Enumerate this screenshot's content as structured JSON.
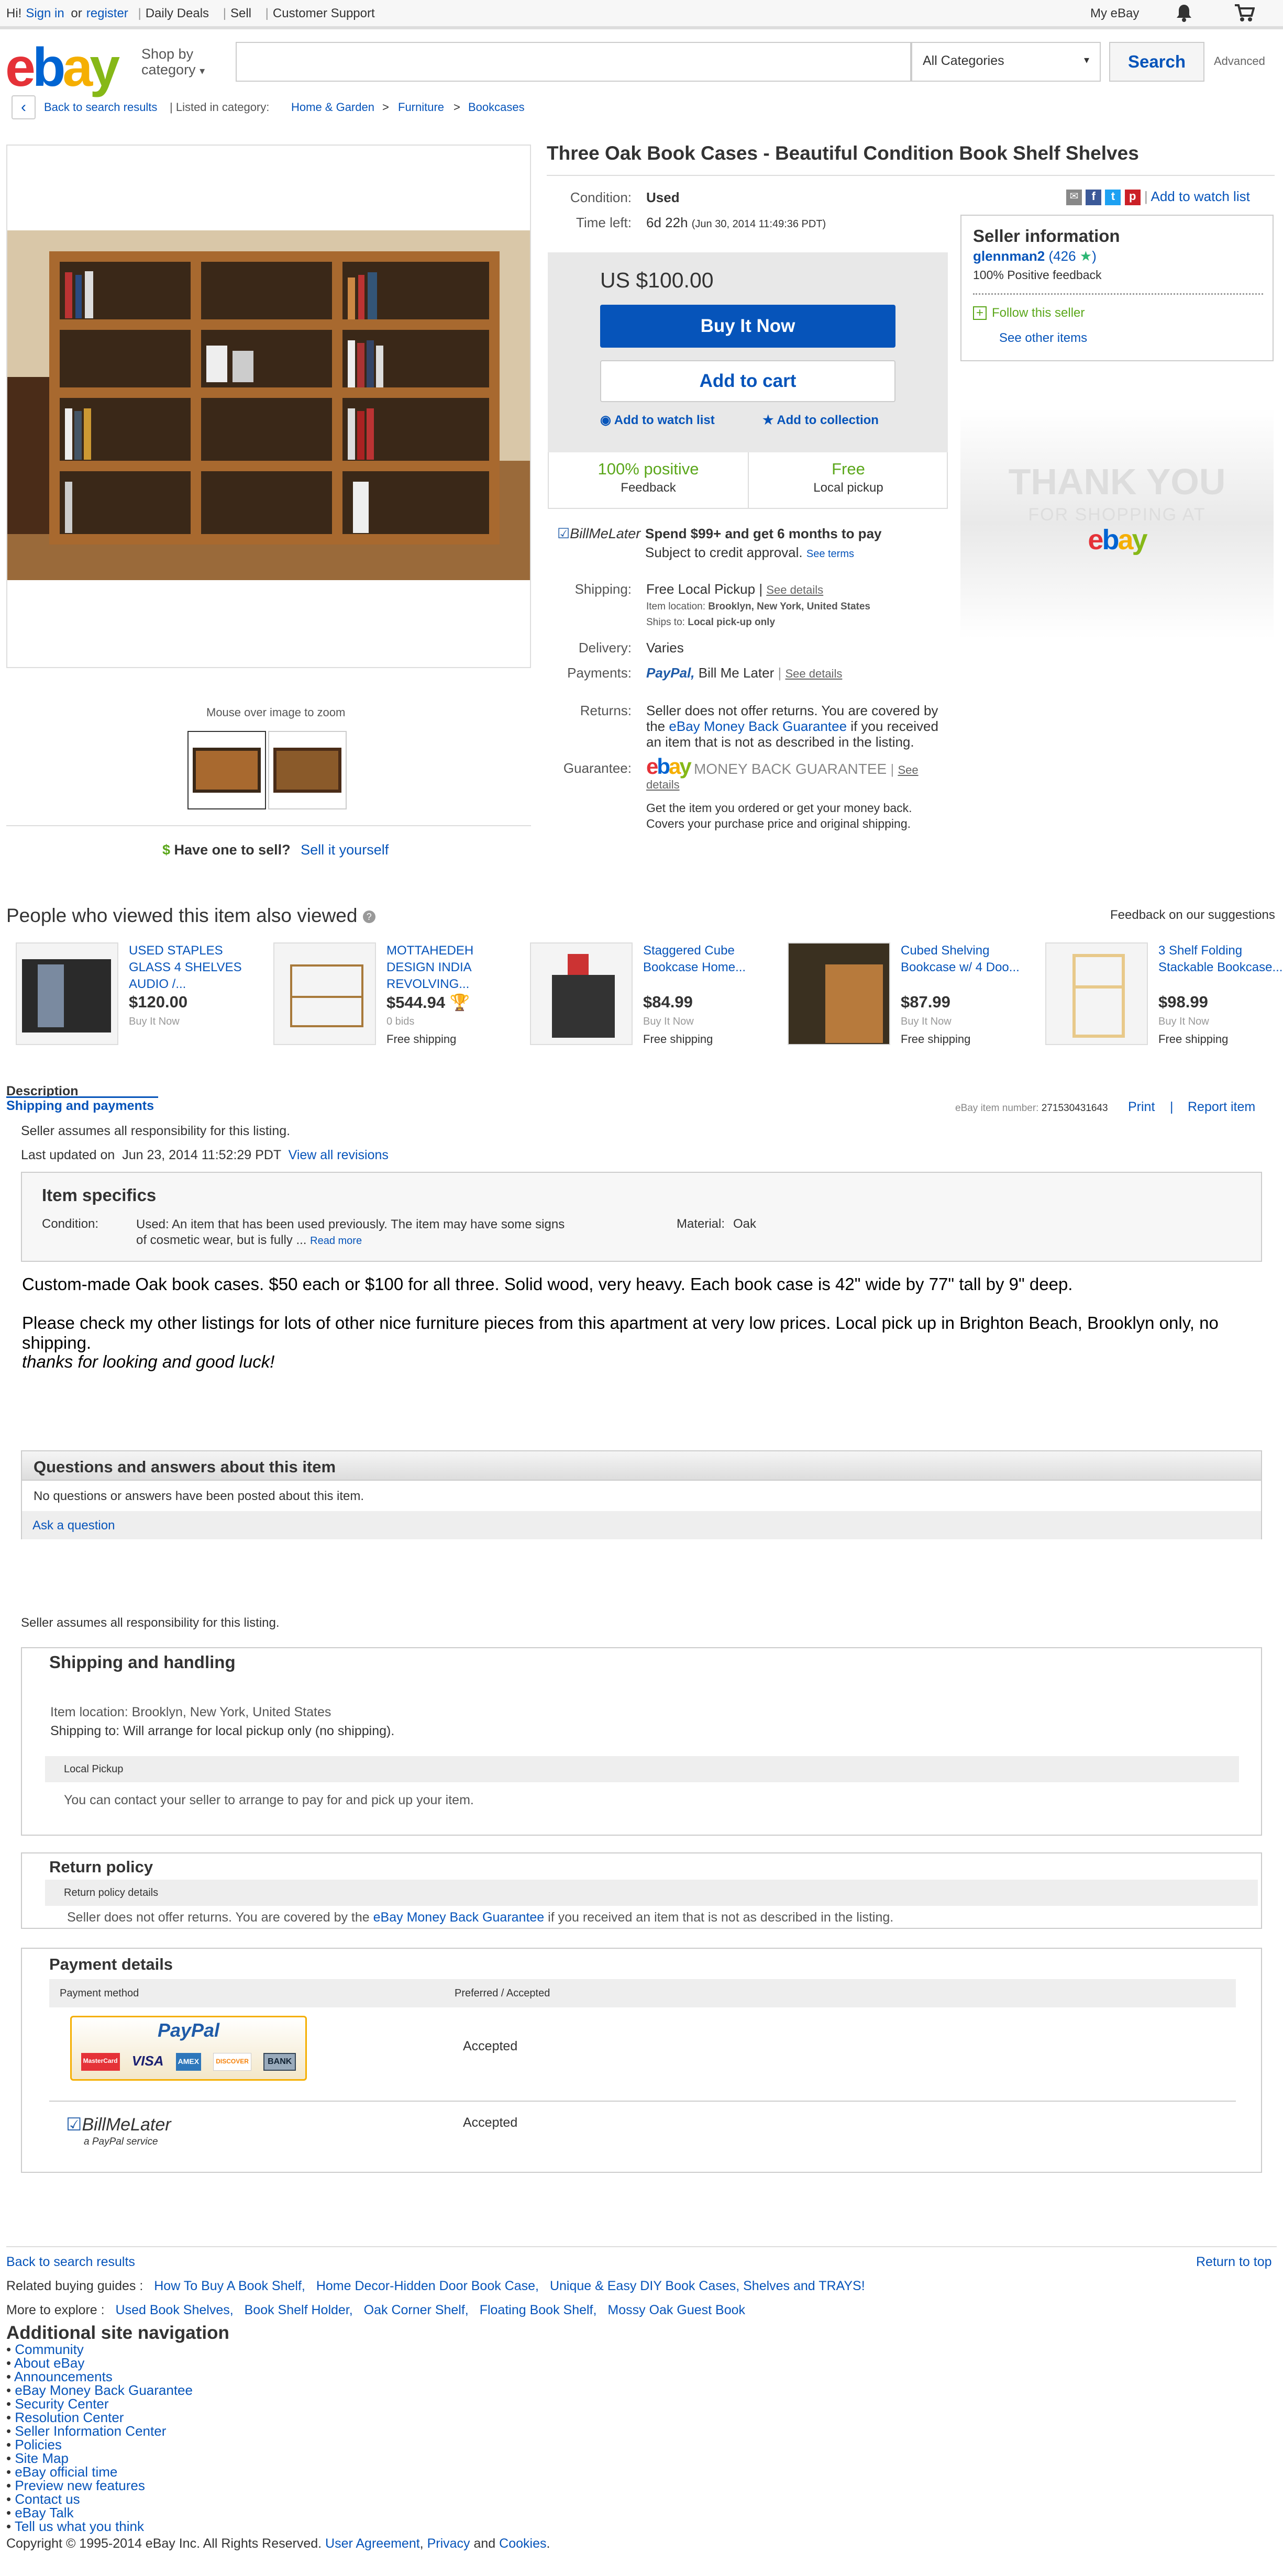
{
  "topbar": {
    "hi": "Hi!",
    "sign_in": "Sign in",
    "or": "or",
    "register": "register",
    "daily_deals": "Daily Deals",
    "sell": "Sell",
    "customer_support": "Customer Support",
    "my_ebay": "My eBay"
  },
  "header": {
    "shop_by": "Shop by",
    "category": "category",
    "category_select": "All Categories",
    "search_button": "Search",
    "advanced": "Advanced"
  },
  "breadcrumb": {
    "back": "Back to search results",
    "listed_in": "Listed in category:",
    "items": [
      "Home & Garden",
      "Furniture",
      "Bookcases"
    ],
    "sep": ">"
  },
  "gallery": {
    "zoom_hint": "Mouse over image to zoom",
    "sell_prompt": "Have one to sell?",
    "sell_link": "Sell it yourself"
  },
  "item": {
    "title": "Three Oak Book Cases - Beautiful Condition Book Shelf Shelves",
    "condition_label": "Condition:",
    "condition": "Used",
    "time_left_label": "Time left:",
    "time_left": "6d 22h",
    "time_left_detail": "(Jun 30, 2014   11:49:36 PDT)",
    "add_watch": "Add to watch list",
    "price": "US $100.00",
    "buy_now": "Buy It Now",
    "add_cart": "Add to cart",
    "watch_link": "Add to watch list",
    "collection_link": "Add to collection",
    "feedback_pct": "100% positive",
    "feedback_lbl": "Feedback",
    "free": "Free",
    "local_pickup": "Local pickup",
    "bml_logo": "BillMeLater",
    "bml_offer": "Spend $99+ and get 6 months to pay",
    "bml_sub": "Subject to credit approval.",
    "see_terms": "See terms",
    "shipping_label": "Shipping:",
    "shipping": "Free Local Pickup",
    "see_details": "See details",
    "item_location_lbl": "Item location:",
    "item_location": "Brooklyn, New York, United States",
    "ships_to_lbl": "Ships to:",
    "ships_to": "Local pick-up only",
    "delivery_label": "Delivery:",
    "delivery": "Varies",
    "payments_label": "Payments:",
    "paypal": "PayPal,",
    "bill_me_later": "Bill Me Later",
    "see_details2": "See details",
    "returns_label": "Returns:",
    "returns_1": "Seller does not offer returns. You are covered by",
    "returns_2": "the",
    "returns_link": "eBay Money Back Guarantee",
    "returns_3": "if you received",
    "returns_4": "an item that is not as described in the listing.",
    "guarantee_label": "Guarantee:",
    "mbg": "MONEY BACK GUARANTEE",
    "see": "See",
    "details": "details",
    "guarantee_desc_1": "Get the item you ordered or get your money back.",
    "guarantee_desc_2": "Covers your purchase price and original shipping."
  },
  "seller": {
    "heading": "Seller information",
    "name": "glennman2",
    "score": "(426",
    "positive": "100% Positive feedback",
    "follow": "Follow this seller",
    "other": "See other items"
  },
  "thankyou": {
    "line1": "THANK YOU",
    "line2": "FOR SHOPPING AT",
    "logo": "ebay"
  },
  "also_viewed": {
    "heading": "People who viewed this item also viewed",
    "feedback_link": "Feedback on our suggestions",
    "items": [
      {
        "title": "USED STAPLES GLASS 4 SHELVES AUDIO /...",
        "price": "$120.00",
        "sub": "Buy It Now",
        "ship": ""
      },
      {
        "title": "MOTTAHEDEH DESIGN INDIA REVOLVING...",
        "price": "$544.94",
        "sub": "0 bids",
        "ship": "Free shipping"
      },
      {
        "title": "Staggered Cube Bookcase Home...",
        "price": "$84.99",
        "sub": "Buy It Now",
        "ship": "Free shipping"
      },
      {
        "title": "Cubed Shelving Bookcase w/ 4 Doo...",
        "price": "$87.99",
        "sub": "Buy It Now",
        "ship": "Free shipping"
      },
      {
        "title": "3 Shelf Folding Stackable Bookcase...",
        "price": "$98.99",
        "sub": "Buy It Now",
        "ship": "Free shipping"
      }
    ]
  },
  "description": {
    "tab_desc": "Description",
    "tab_ship": "Shipping and payments",
    "item_number_lbl": "eBay item number:",
    "item_number": "271530431643",
    "print": "Print",
    "report": "Report item",
    "responsibility": "Seller assumes all responsibility for this listing.",
    "last_updated_lbl": "Last updated on",
    "last_updated": "Jun 23, 2014 11:52:29 PDT",
    "view_revisions": "View all revisions",
    "specifics_heading": "Item specifics",
    "cond_lbl": "Condition:",
    "cond_val_1": "Used: An item that has been used previously. The item may have some signs",
    "cond_val_2": "of cosmetic wear, but is fully ...",
    "read_more": "Read more",
    "material_lbl": "Material:",
    "material": "Oak",
    "para1": "Custom-made Oak book cases.  $50 each or $100 for all three.  Solid wood, very heavy.  Each book case is 42\" wide by 77\" tall by 9\" deep.",
    "para2": "Please check my other listings for lots of other nice furniture pieces from this apartment at very low prices.  Local pick up in Brighton Beach, Brooklyn only, no shipping.",
    "para3": "thanks for looking and good luck!"
  },
  "qa": {
    "heading": "Questions and answers about this item",
    "none": "No questions or answers have been posted about this item.",
    "ask": "Ask a question"
  },
  "shipping_section": {
    "responsibility": "Seller assumes all responsibility for this listing.",
    "heading": "Shipping and handling",
    "location": "Item location: Brooklyn, New York, United States",
    "ship_to": "Shipping to: Will arrange for local pickup only (no shipping).",
    "local_pickup": "Local Pickup",
    "contact": "You can contact your seller to arrange to pay for and pick up your item."
  },
  "return_section": {
    "heading": "Return policy",
    "details": "Return policy details",
    "text_1": "Seller does not offer returns. You are covered by the",
    "link": "eBay Money Back Guarantee",
    "text_2": "if you received an item that is not as described in the listing."
  },
  "payment_section": {
    "heading": "Payment details",
    "col_method": "Payment method",
    "col_pref": "Preferred / Accepted",
    "paypal_logo": "PayPal",
    "cards": [
      "MasterCard",
      "VISA",
      "AMEX",
      "DISCOVER",
      "BANK"
    ],
    "accepted1": "Accepted",
    "bml": "BillMeLater",
    "bml_sub": "a PayPal service",
    "accepted2": "Accepted"
  },
  "footer": {
    "back": "Back to search results",
    "top": "Return to top",
    "guides_lbl": "Related buying guides :",
    "guides": [
      "How To Buy A Book Shelf,",
      "Home Decor-Hidden Door Book Case,",
      "Unique & Easy DIY Book Cases, Shelves and TRAYS!"
    ],
    "explore_lbl": "More to explore :",
    "explore": [
      "Used Book Shelves,",
      "Book Shelf Holder,",
      "Oak Corner Shelf,",
      "Floating Book Shelf,",
      "Mossy Oak Guest Book"
    ],
    "nav_heading": "Additional site navigation",
    "nav": [
      "Community",
      "About eBay",
      "Announcements",
      "eBay Money Back Guarantee",
      "Security Center",
      "Resolution Center",
      "Seller Information Center",
      "Policies",
      "Site Map",
      "eBay official time",
      "Preview new features",
      "Contact us",
      "eBay Talk",
      "Tell us what you think"
    ],
    "copyright": "Copyright © 1995-2014 eBay Inc. All Rights Reserved.",
    "user_agreement": "User Agreement",
    "comma": ",",
    "privacy": "Privacy",
    "and": "and",
    "cookies": "Cookies",
    "dot": "."
  }
}
